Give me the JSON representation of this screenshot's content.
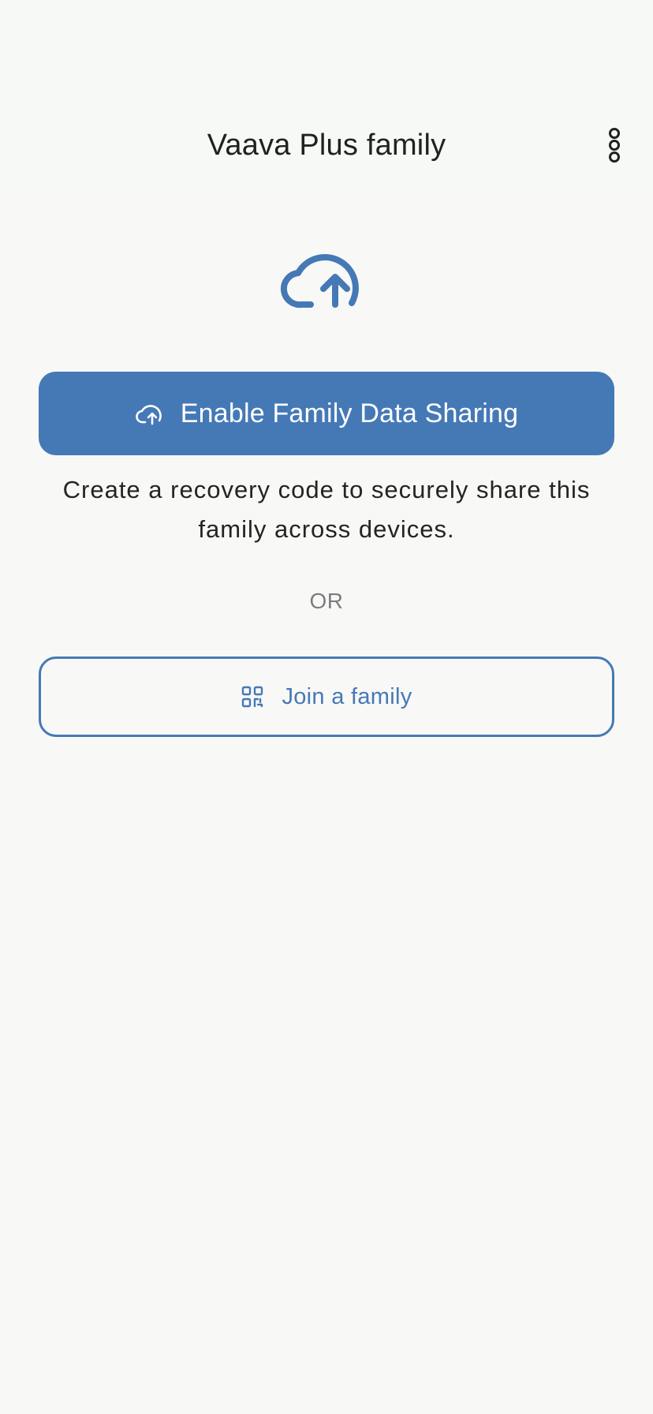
{
  "header": {
    "title": "Vaava Plus family",
    "menu_icon": "more-vertical-icon"
  },
  "hero": {
    "icon": "cloud-upload-icon"
  },
  "actions": {
    "enable_label": "Enable Family Data Sharing",
    "enable_icon": "cloud-upload-icon",
    "description": "Create a recovery code to securely share this family across devices.",
    "separator": "OR",
    "join_label": "Join a family",
    "join_icon": "qr-code-icon"
  },
  "colors": {
    "accent": "#4579b6",
    "background": "#f8f8f7",
    "header_background": "#f6f9f5",
    "text": "#1f2220",
    "muted_text": "#7c7e7d"
  }
}
